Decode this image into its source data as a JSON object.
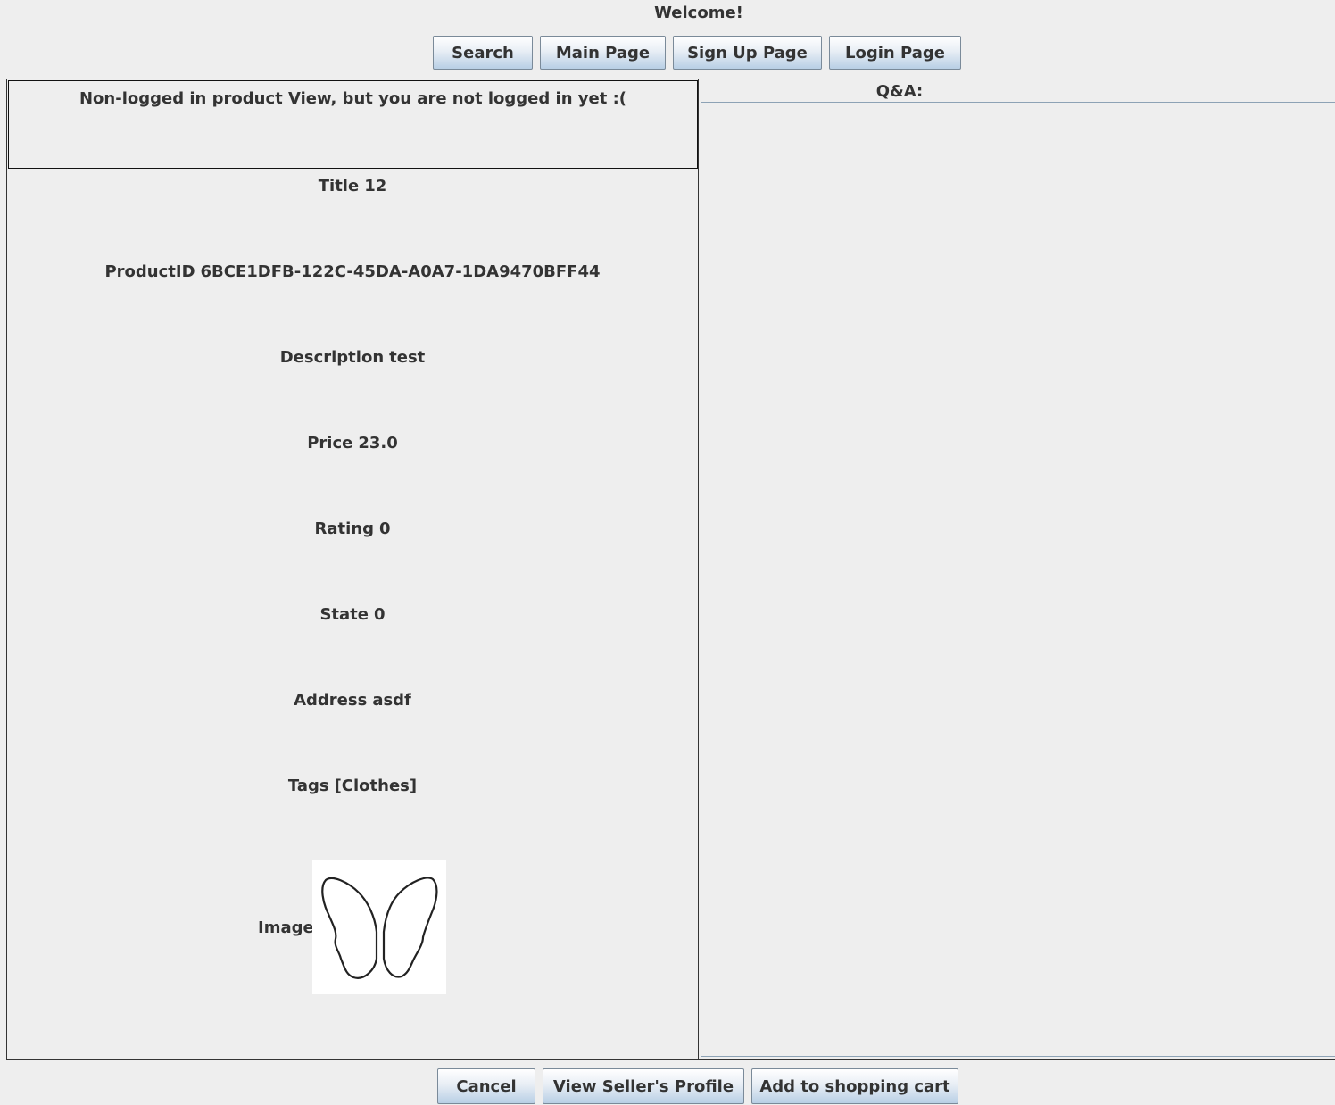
{
  "header": {
    "welcome": "Welcome!"
  },
  "nav": {
    "search": "Search",
    "main_page": "Main Page",
    "sign_up_page": "Sign Up Page",
    "login_page": "Login Page"
  },
  "notice": "Non-logged in product View, but you are not logged in yet :(",
  "product": {
    "title_label": "Title",
    "title_value": "12",
    "id_label": "ProductID",
    "id_value": "6BCE1DFB-122C-45DA-A0A7-1DA9470BFF44",
    "description_label": "Description",
    "description_value": "test",
    "price_label": "Price",
    "price_value": "23.0",
    "rating_label": "Rating",
    "rating_value": "0",
    "state_label": "State",
    "state_value": "0",
    "address_label": "Address",
    "address_value": "asdf",
    "tags_label": "Tags",
    "tags_value": "[Clothes]",
    "image_label": "Image",
    "image_icon": "butterfly-wings-outline"
  },
  "qa": {
    "label": "Q&A:"
  },
  "footer": {
    "cancel": "Cancel",
    "view_seller": "View Seller's Profile",
    "add_to_cart": "Add to shopping cart"
  }
}
